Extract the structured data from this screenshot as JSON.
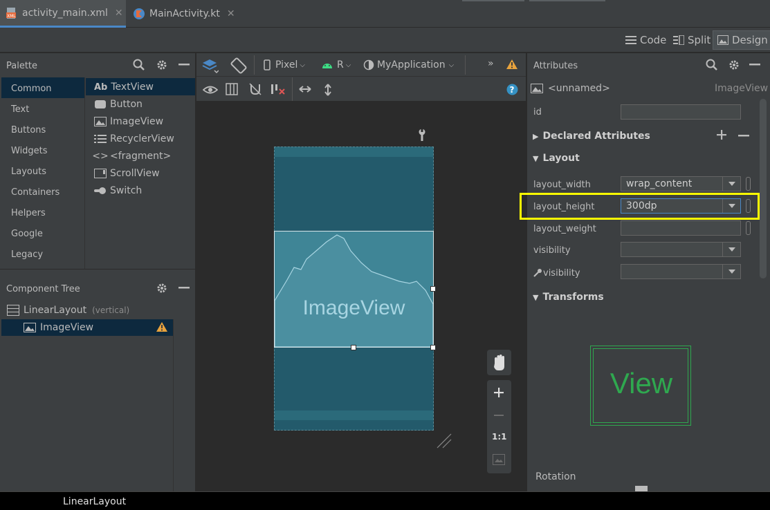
{
  "tabs": [
    {
      "label": "activity_main.xml",
      "icon": "xml-file-icon",
      "active": true
    },
    {
      "label": "MainActivity.kt",
      "icon": "kotlin-file-icon",
      "active": false
    }
  ],
  "view_modes": {
    "code": "Code",
    "split": "Split",
    "design": "Design",
    "active": "Design"
  },
  "palette": {
    "title": "Palette",
    "categories": [
      "Common",
      "Text",
      "Buttons",
      "Widgets",
      "Layouts",
      "Containers",
      "Helpers",
      "Google",
      "Legacy"
    ],
    "selected_category": "Common",
    "items": [
      {
        "label": "TextView",
        "icon_text": "Ab"
      },
      {
        "label": "Button"
      },
      {
        "label": "ImageView"
      },
      {
        "label": "RecyclerView"
      },
      {
        "label": "<fragment>"
      },
      {
        "label": "ScrollView"
      },
      {
        "label": "Switch"
      }
    ]
  },
  "component_tree": {
    "title": "Component Tree",
    "root_label": "LinearLayout",
    "root_hint": "(vertical)",
    "child_label": "ImageView"
  },
  "toolbar": {
    "device": "Pixel",
    "api": "R",
    "theme": "MyApplication",
    "overflow": "»"
  },
  "canvas": {
    "imageview_label": "ImageView",
    "zoom_fit": "1:1"
  },
  "attributes": {
    "title": "Attributes",
    "name_placeholder": "<unnamed>",
    "type": "ImageView",
    "id_label": "id",
    "id_value": "",
    "declared_section": "Declared Attributes",
    "layout_section": "Layout",
    "rows": [
      {
        "label": "layout_width",
        "value": "wrap_content"
      },
      {
        "label": "layout_height",
        "value": "300dp",
        "highlighted": true
      },
      {
        "label": "layout_weight",
        "value": ""
      },
      {
        "label": "visibility",
        "value": ""
      },
      {
        "label": "visibility",
        "value": ""
      }
    ],
    "transforms_section": "Transforms",
    "view_preview": "View",
    "rotation_label": "Rotation"
  },
  "status_bar": {
    "text": "LinearLayout"
  },
  "colors": {
    "highlight": "#ffff00",
    "warning": "#e8a33d",
    "selection": "#0d293e",
    "accent": "#4a88c7"
  }
}
